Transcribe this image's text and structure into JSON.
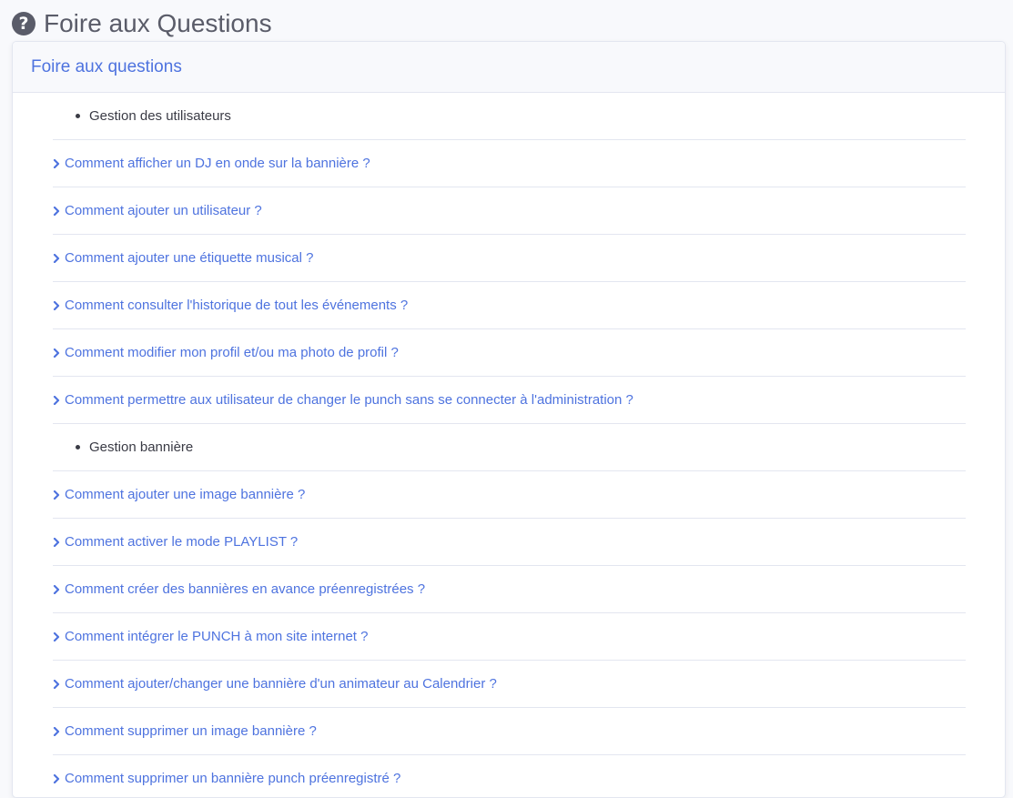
{
  "page": {
    "title": "Foire aux Questions",
    "icon": "question-circle-icon"
  },
  "card": {
    "header": "Foire aux questions"
  },
  "colors": {
    "accent": "#4e73df",
    "text": "#3a3b45",
    "title": "#5a5c69",
    "divider": "#e3e6f0"
  },
  "items": [
    {
      "type": "section",
      "label": "Gestion des utilisateurs"
    },
    {
      "type": "question",
      "label": "Comment afficher un DJ en onde sur la bannière ?"
    },
    {
      "type": "question",
      "label": "Comment ajouter un utilisateur ?"
    },
    {
      "type": "question",
      "label": "Comment ajouter une étiquette musical ?"
    },
    {
      "type": "question",
      "label": "Comment consulter l'historique de tout les événements ?"
    },
    {
      "type": "question",
      "label": "Comment modifier mon profil et/ou ma photo de profil ?"
    },
    {
      "type": "question",
      "label": "Comment permettre aux utilisateur de changer le punch sans se connecter à l'administration ?"
    },
    {
      "type": "section",
      "label": "Gestion bannière"
    },
    {
      "type": "question",
      "label": "Comment ajouter une image bannière ?"
    },
    {
      "type": "question",
      "label": "Comment activer le mode PLAYLIST ?"
    },
    {
      "type": "question",
      "label": "Comment créer des bannières en avance préenregistrées ?"
    },
    {
      "type": "question",
      "label": "Comment intégrer le PUNCH à mon site internet ?"
    },
    {
      "type": "question",
      "label": "Comment ajouter/changer une bannière d'un animateur au Calendrier ?"
    },
    {
      "type": "question",
      "label": "Comment supprimer un image bannière ?"
    },
    {
      "type": "question",
      "label": "Comment supprimer un bannière punch préenregistré ?"
    }
  ]
}
